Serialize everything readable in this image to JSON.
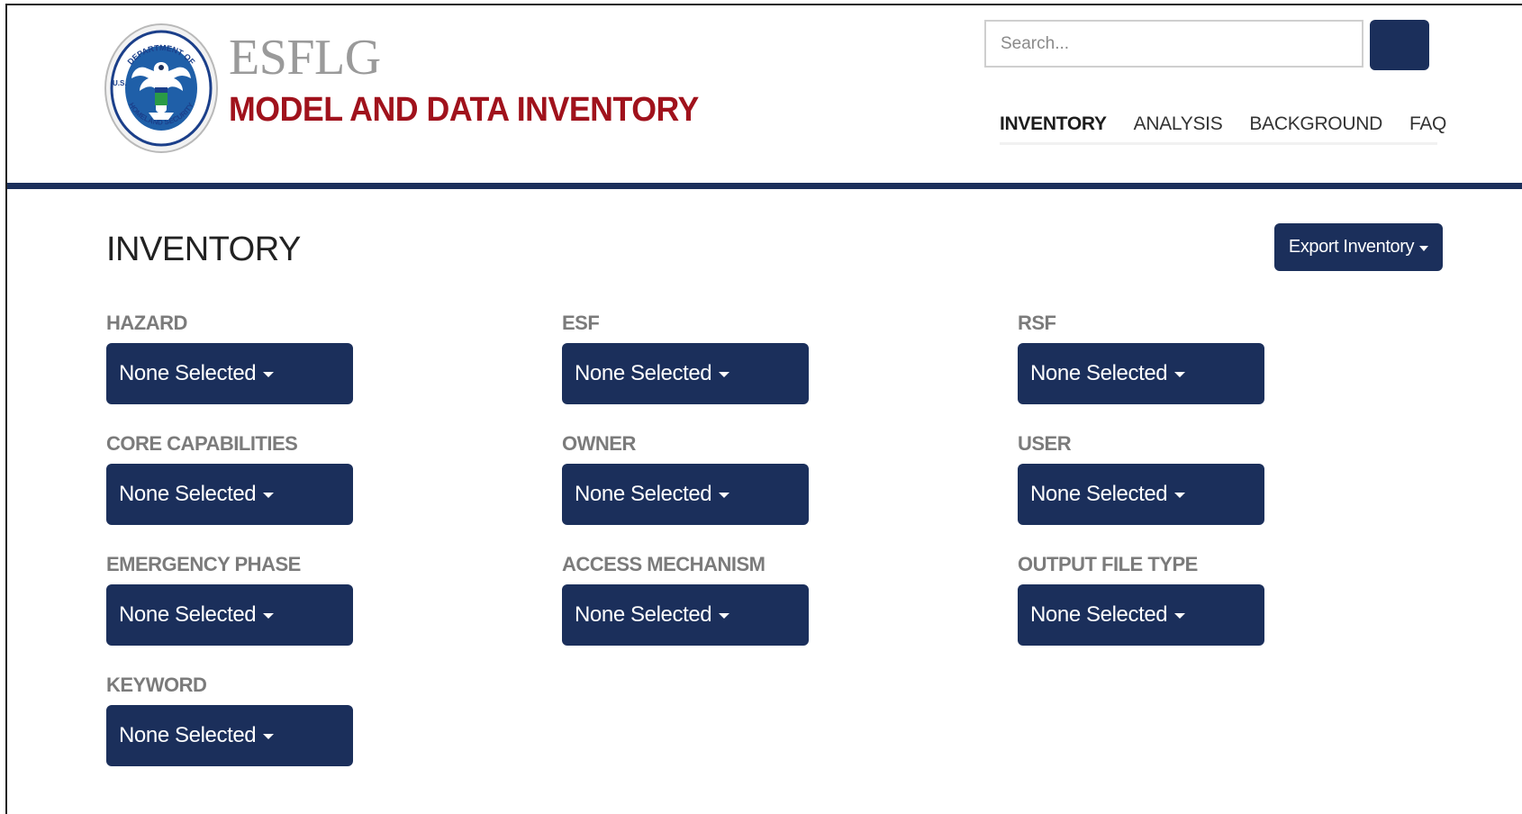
{
  "header": {
    "brand_name": "ESFLG",
    "brand_subtitle": "MODEL AND DATA INVENTORY",
    "seal_text_top": "DEPARTMENT OF",
    "seal_text_bottom": "HOMELAND SECURITY",
    "seal_text_us": "U.S.",
    "search": {
      "placeholder": "Search..."
    },
    "nav": [
      "INVENTORY",
      "ANALYSIS",
      "BACKGROUND",
      "FAQ"
    ],
    "active_nav": "INVENTORY"
  },
  "page": {
    "title": "INVENTORY",
    "export_label": "Export Inventory"
  },
  "filters": [
    {
      "label": "HAZARD",
      "value": "None Selected"
    },
    {
      "label": "ESF",
      "value": "None Selected"
    },
    {
      "label": "RSF",
      "value": "None Selected"
    },
    {
      "label": "CORE CAPABILITIES",
      "value": "None Selected"
    },
    {
      "label": "OWNER",
      "value": "None Selected"
    },
    {
      "label": "USER",
      "value": "None Selected"
    },
    {
      "label": "EMERGENCY PHASE",
      "value": "None Selected"
    },
    {
      "label": "ACCESS MECHANISM",
      "value": "None Selected"
    },
    {
      "label": "OUTPUT FILE TYPE",
      "value": "None Selected"
    },
    {
      "label": "KEYWORD",
      "value": "None Selected"
    }
  ],
  "icons": {
    "seal": "dhs-seal-icon",
    "search_button": "search-button",
    "caret": "caret-down-icon"
  },
  "colors": {
    "navy": "#1b2f5b",
    "brand_red": "#a0121c",
    "brand_gray": "#9a9a9a",
    "label_gray": "#7b7b7b"
  }
}
